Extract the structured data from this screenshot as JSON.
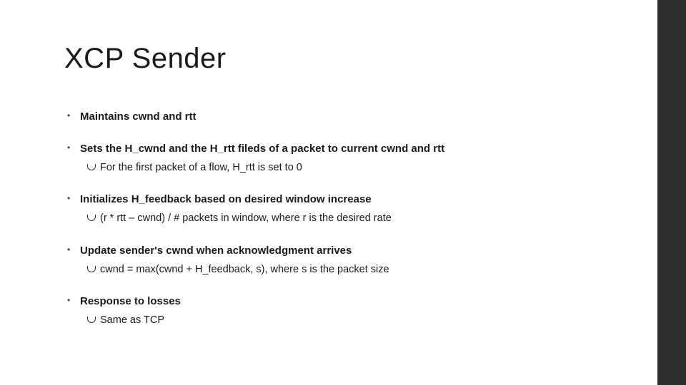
{
  "title": "XCP Sender",
  "bullets": [
    {
      "text": "Maintains cwnd and rtt",
      "sub": []
    },
    {
      "text": "Sets the H_cwnd and the H_rtt fileds of a packet to current cwnd and rtt",
      "sub": [
        "For the first packet of a flow, H_rtt is set to 0"
      ]
    },
    {
      "text": "Initializes H_feedback based on desired window increase",
      "sub": [
        "(r * rtt – cwnd) / # packets in window, where r is the desired rate"
      ]
    },
    {
      "text": "Update sender's cwnd when acknowledgment arrives",
      "sub": [
        "cwnd = max(cwnd + H_feedback, s), where s is the packet size"
      ]
    },
    {
      "text": "Response to losses",
      "sub": [
        "Same as TCP"
      ]
    }
  ]
}
